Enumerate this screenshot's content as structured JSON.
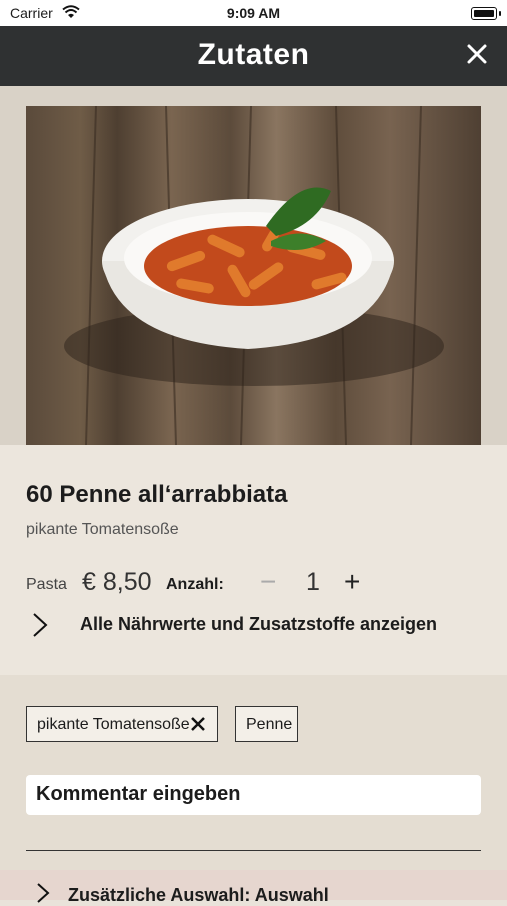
{
  "status": {
    "carrier": "Carrier",
    "time": "9:09 AM"
  },
  "header": {
    "title": "Zutaten"
  },
  "item": {
    "title": "60 Penne all‘arrabbiata",
    "subtitle": "pikante Tomatensoße",
    "category": "Pasta",
    "price": "€ 8,50",
    "quantity_label": "Anzahl:",
    "quantity": "1",
    "minus": "−",
    "plus": "+"
  },
  "nutrition": {
    "label": "Alle Nährwerte und Zusatzstoffe anzeigen"
  },
  "chips": [
    {
      "label": "pikante Tomatensoße",
      "removable": true
    },
    {
      "label": "Penne",
      "removable": false
    }
  ],
  "comment": {
    "placeholder": "Kommentar eingeben"
  },
  "extra": {
    "label": "Zusätzliche Auswahl: Auswahl"
  },
  "colors": {
    "header_bg": "#2f3132",
    "background": "#e9e3da"
  },
  "icons": [
    "wifi-icon",
    "battery-icon",
    "close-icon",
    "chevron-right-icon",
    "remove-icon"
  ]
}
